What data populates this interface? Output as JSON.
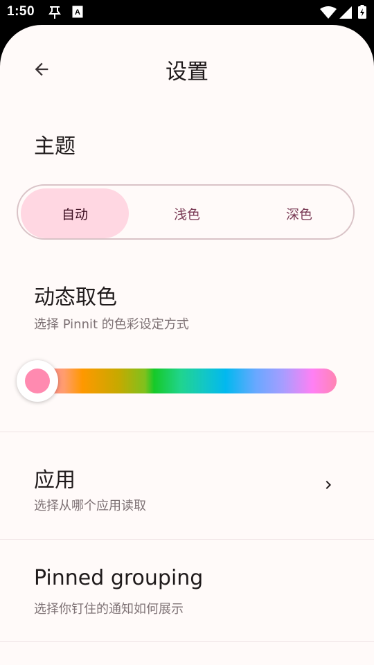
{
  "status_bar": {
    "time": "1:50"
  },
  "topbar": {
    "title": "设置"
  },
  "theme": {
    "title": "主题",
    "options": [
      "自动",
      "浅色",
      "深色"
    ],
    "selected": "自动"
  },
  "dynamic_color": {
    "title": "动态取色",
    "subtitle": "选择 Pinnit 的色彩设定方式",
    "slider_value": 0
  },
  "apps": {
    "title": "应用",
    "subtitle": "选择从哪个应用读取"
  },
  "pinned_grouping": {
    "title": "Pinned grouping",
    "subtitle": "选择你钉住的通知如何展示"
  },
  "colors": {
    "background": "#fffaf9",
    "selected_segment": "#ffd7e2",
    "accent": "#ff8ab0"
  }
}
